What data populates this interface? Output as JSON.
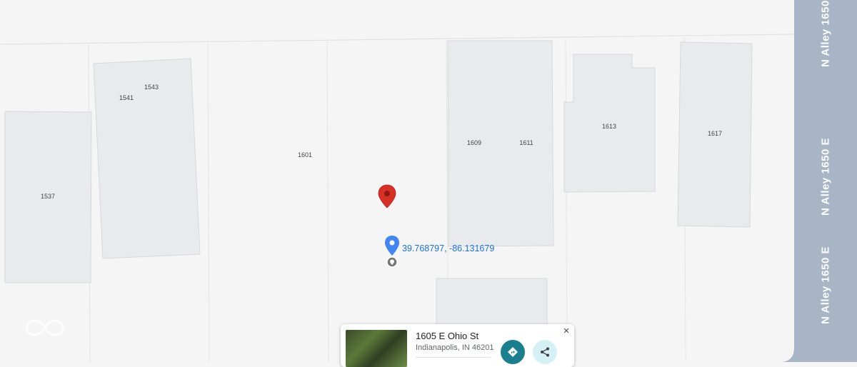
{
  "map": {
    "street_name": "N Alley 1650 E",
    "coordinates": "39.768797, -86.131679",
    "parcels": [
      {
        "id": "1537",
        "label": "1537"
      },
      {
        "id": "1541",
        "label": "1541"
      },
      {
        "id": "1543",
        "label": "1543"
      },
      {
        "id": "1601",
        "label": "1601"
      },
      {
        "id": "1609",
        "label": "1609"
      },
      {
        "id": "1611",
        "label": "1611"
      },
      {
        "id": "1613",
        "label": "1613"
      },
      {
        "id": "1617",
        "label": "1617"
      }
    ],
    "colors": {
      "background": "#f5f5f5",
      "building": "#e8eaed",
      "road": "#a8b5c6",
      "lot_line": "#e2e2e2",
      "red_pin": "#d93025",
      "blue_pin": "#4285f4",
      "coordinate_text": "#1a73e8"
    }
  },
  "info_card": {
    "title": "1605 E Ohio St",
    "subtitle": "Indianapolis, IN 46201",
    "directions_icon": "directions-icon",
    "share_icon": "share-icon",
    "close_symbol": "×"
  },
  "watermark": {
    "icon": "infinity-logo-icon",
    "text": ""
  }
}
